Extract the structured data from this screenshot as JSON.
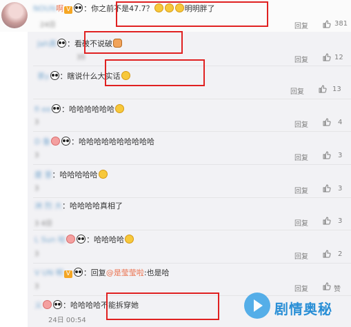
{
  "main_comment": {
    "user": "NOUN",
    "user_suffix": "啊",
    "text_prefix": "：你之前不是47.7？",
    "text_suffix": "明明胖了",
    "time": "24日",
    "reply_label": "回复",
    "likes": "381"
  },
  "replies": [
    {
      "user": "Jah真",
      "text": "：看破不说破",
      "time": "35",
      "reply_label": "回复",
      "likes": "12"
    },
    {
      "user": "茶y",
      "text": "：瞎说什么大实话",
      "time": "",
      "reply_label": "回复",
      "likes": "13"
    },
    {
      "user": "fi ee",
      "text": "：哈哈哈哈哈哈",
      "time": "3",
      "reply_label": "回复",
      "likes": "4"
    },
    {
      "user": "D 鲁",
      "text": "：哈哈哈哈哈哈哈哈哈哈",
      "time": "3",
      "reply_label": "回复",
      "likes": "3"
    },
    {
      "user": "廈 里",
      "text": "：哈哈哈哈哈",
      "time": "3",
      "reply_label": "回复",
      "likes": "3"
    },
    {
      "user": "洲 烈 大",
      "text": "：哈哈哈哈真相了",
      "time": "3 4日",
      "reply_label": "回复",
      "likes": "3"
    },
    {
      "user": "L Sun 哈",
      "text": "：哈哈哈哈",
      "time": "3",
      "reply_label": "回复",
      "likes": "2"
    },
    {
      "user": "V UN 啊",
      "text_prefix": "：回复",
      "mention": "@是莹莹啦",
      "text_suffix": ":也是哈",
      "time": "3",
      "reply_label": "回复",
      "likes": "赞"
    },
    {
      "user": "义",
      "text": "：哈哈哈哈不能拆穿她",
      "time": "24日 00:54",
      "reply_label": "回复",
      "likes": "1"
    }
  ],
  "watermark": {
    "text": "剧情奥秘"
  },
  "icons": {
    "thumb": "thumbs-up-icon",
    "panda": "panda-emoji-icon",
    "doge": "doge-emoji-icon",
    "laugh": "laugh-emoji-icon",
    "vip": "vip-badge-icon"
  },
  "colors": {
    "username": "#eb7350",
    "mention": "#eb7350",
    "highlight": "#e02020",
    "thread_bg": "#f2f2f5"
  }
}
